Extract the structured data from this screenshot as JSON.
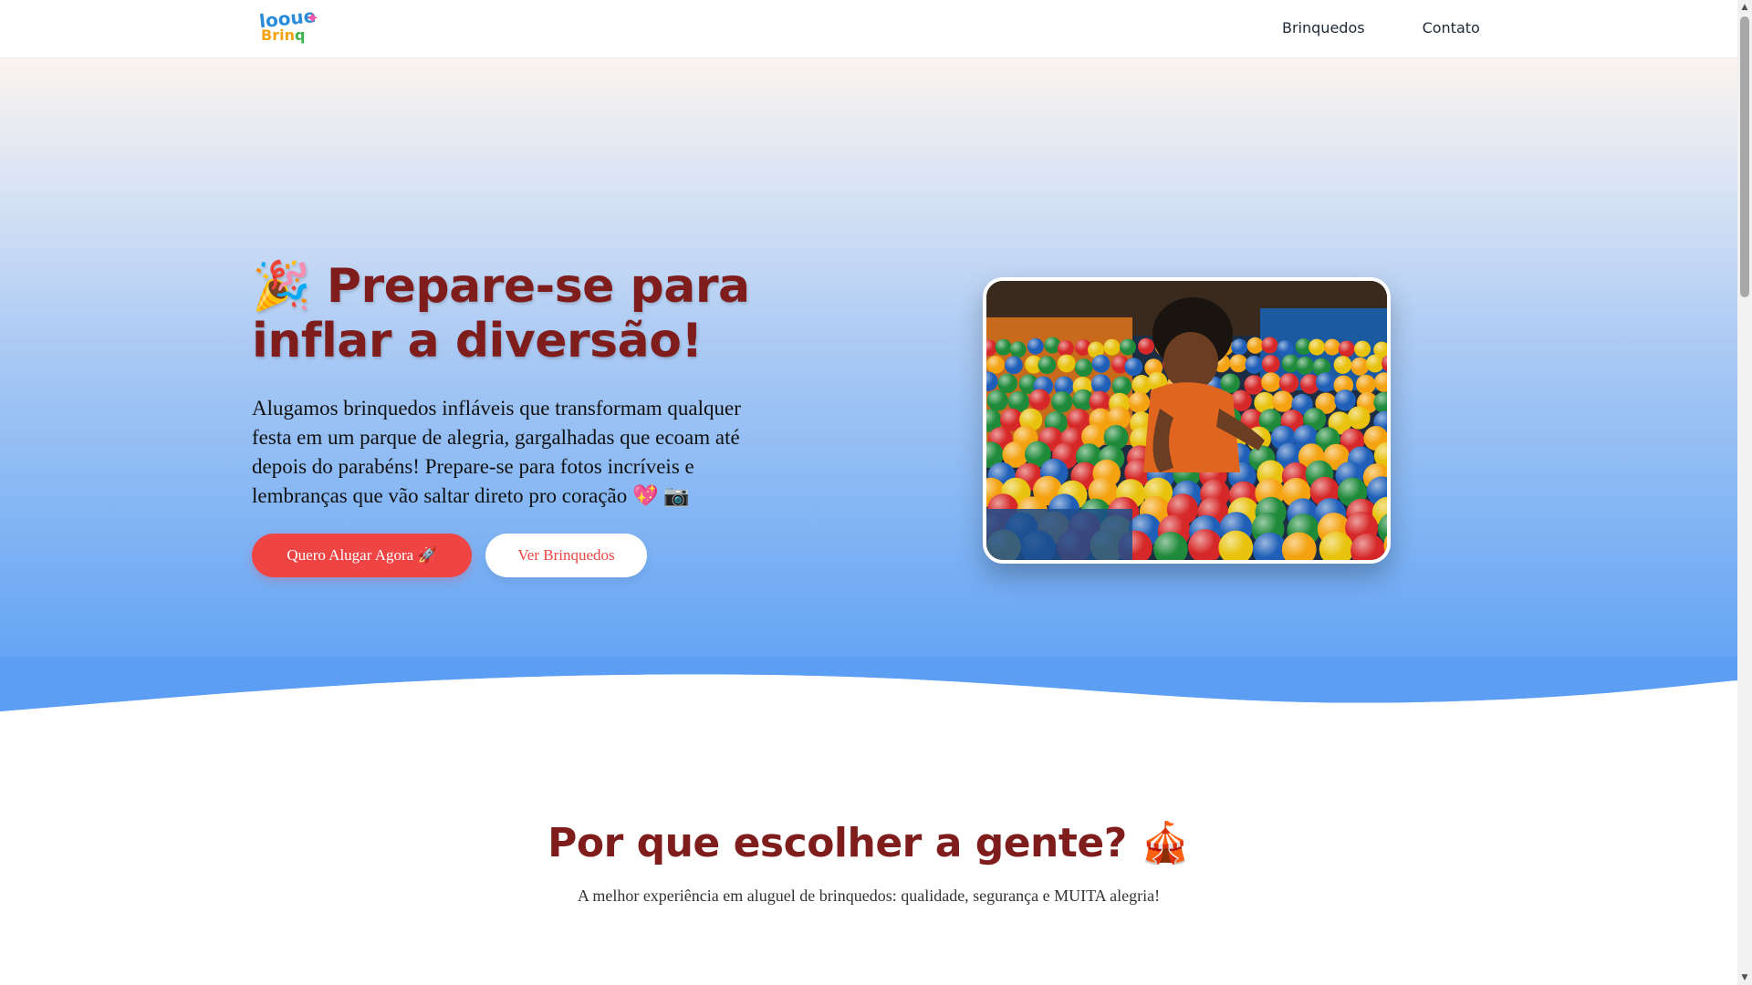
{
  "header": {
    "logo": {
      "line1": "looue",
      "line2_a": "Brin",
      "line2_b": "q"
    },
    "nav": {
      "toys": "Brinquedos",
      "contact": "Contato"
    }
  },
  "hero": {
    "title_emoji": "🎉",
    "title": "Prepare-se para inflar a diversão!",
    "description": "Alugamos brinquedos infláveis que transformam qualquer festa em um parque de alegria, gargalhadas que ecoam até depois do parabéns! Prepare-se para fotos incríveis e lembranças que vão saltar direto pro coração 💖 📷",
    "primary_button": "Quero Alugar Agora 🚀",
    "secondary_button": "Ver Brinquedos"
  },
  "why": {
    "title": "Por que escolher a gente? 🎪",
    "subtitle": "A melhor experiência em aluguel de brinquedos: qualidade, segurança e MUITA alegria!"
  },
  "colors": {
    "accent": "#ef4444",
    "heading": "#7f1d1d",
    "hero_bottom": "#5b9ef4"
  },
  "scrollbar": {
    "up": "▲",
    "down": "▼"
  }
}
